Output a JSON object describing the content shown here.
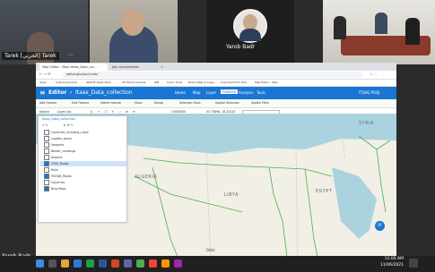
{
  "participants": [
    {
      "name": "Tarek [الحربي] Tarek"
    },
    {
      "name": ""
    },
    {
      "name": "Yarob Badr"
    },
    {
      "name": ""
    }
  ],
  "presenter_name": "Yarob Badr",
  "browser": {
    "tabs": [
      "Map Editor - Map: Itaas_Data_col...",
      "Join conversation"
    ],
    "address": "editor.giscloud.com/",
    "bookmarks": [
      "Apps",
      "Culture General",
      "GRADE Application",
      "CE World General",
      "WB",
      "Iconic Tools",
      "Brand Web & Augu...",
      "Imported From Fire...",
      "Map Editor - Map"
    ]
  },
  "app": {
    "title": "Editor",
    "project": "Itaas_Data_collection",
    "nav": [
      "Home",
      "Map",
      "Layer",
      "Feature",
      "Analysis",
      "Tools"
    ],
    "user": "ITDAQ PROJ"
  },
  "toolbar1": [
    "Add Feature",
    "Edit Feature",
    "Delete feature",
    "Move",
    "Range",
    "Selection Tools",
    "Spatial Selection",
    "Spatial Filter"
  ],
  "toolbar2": {
    "search": "Search",
    "layer_list": "Layer List",
    "scale": "1:5000000",
    "coords": "33.75898, 18.31025"
  },
  "layers": {
    "title": "Itaas_Data_collection",
    "items": [
      {
        "name": "Countries_Including_Libya",
        "checked": false,
        "selected": false
      },
      {
        "name": "Logistic_zones",
        "checked": false,
        "selected": false
      },
      {
        "name": "Seaports",
        "checked": false,
        "selected": false
      },
      {
        "name": "Border_crossings",
        "checked": false,
        "selected": false
      },
      {
        "name": "Airports",
        "checked": false,
        "selected": false
      },
      {
        "name": "CIMA_Roads",
        "checked": true,
        "selected": true
      },
      {
        "name": "Rails",
        "checked": false,
        "selected": false
      },
      {
        "name": "ESCWA_Roads",
        "checked": true,
        "selected": false
      },
      {
        "name": "Countries",
        "checked": false,
        "selected": false
      },
      {
        "name": "Bing Maps",
        "checked": true,
        "selected": false
      }
    ]
  },
  "map_labels": {
    "algeria": "ALGERIA",
    "libya": "LIBYA",
    "egypt": "EGYPT",
    "syria": "SYRIA",
    "data": "Data"
  },
  "clock": {
    "time": "11:00 AM",
    "date": "11/06/2021"
  },
  "colors": {
    "accent": "#1976d2",
    "roads": "#4caf50"
  }
}
